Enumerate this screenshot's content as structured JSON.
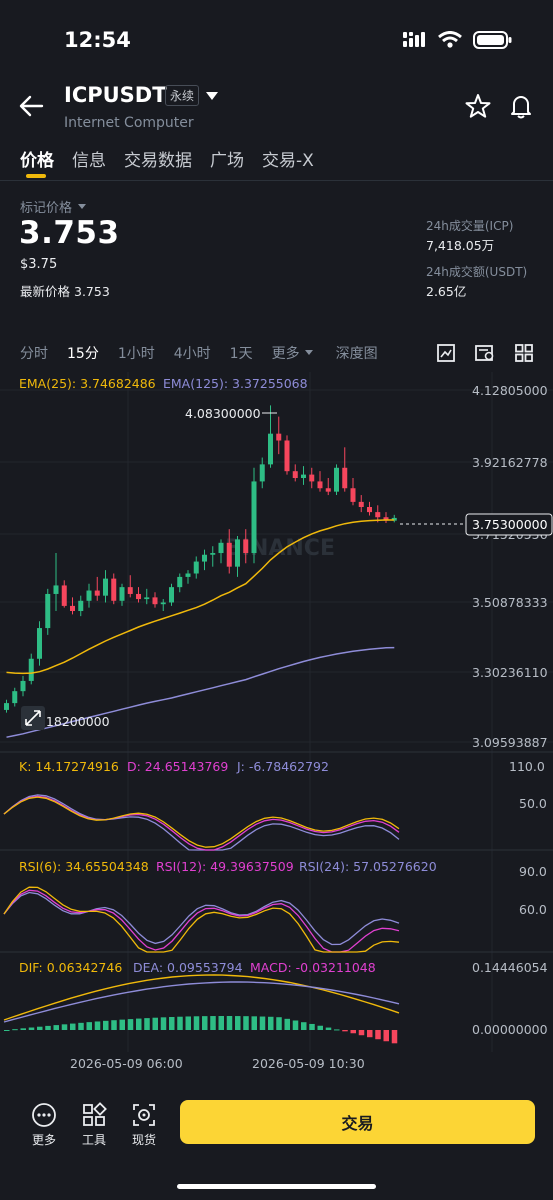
{
  "status": {
    "time": "12:54"
  },
  "header": {
    "symbol": "ICPUSDT",
    "contract_badge": "永续",
    "subtitle": "Internet Computer"
  },
  "tabs": [
    {
      "label": "价格",
      "active": true
    },
    {
      "label": "信息",
      "active": false
    },
    {
      "label": "交易数据",
      "active": false
    },
    {
      "label": "广场",
      "active": false
    },
    {
      "label": "交易-X",
      "active": false
    }
  ],
  "price": {
    "mark_label": "标记价格",
    "value": "3.753",
    "usd": "$3.75",
    "last_label": "最新价格",
    "last_value": "3.753",
    "vol_label": "24h成交量(ICP)",
    "vol_value": "7,418.05万",
    "amt_label": "24h成交额(USDT)",
    "amt_value": "2.65亿"
  },
  "timeframes": [
    {
      "label": "分时",
      "active": false
    },
    {
      "label": "15分",
      "active": true
    },
    {
      "label": "1小时",
      "active": false
    },
    {
      "label": "4小时",
      "active": false
    },
    {
      "label": "1天",
      "active": false
    },
    {
      "label": "更多",
      "active": false
    },
    {
      "label": "深度图",
      "active": false
    }
  ],
  "chart": {
    "ema_labels": [
      "EMA(25): 3.74682486",
      "EMA(125): 3.37255068"
    ],
    "y_ticks": [
      "4.12805000",
      "3.92162778",
      "3.71520556",
      "3.50878333",
      "3.30236110",
      "3.09593887"
    ],
    "current_price_tag": "3.75300000",
    "high_label": "4.08300000",
    "low_label": "3.18200000",
    "watermark": "BINANCE",
    "kdj_labels": [
      "K: 14.17274916",
      "D: 24.65143769",
      "J: -6.78462792"
    ],
    "kdj_ticks": [
      "110.0",
      "50.0"
    ],
    "rsi_labels": [
      "RSI(6): 34.65504348",
      "RSI(12): 49.39637509",
      "RSI(24): 57.05276620"
    ],
    "rsi_ticks": [
      "90.0",
      "60.0"
    ],
    "macd_labels": [
      "DIF: 0.06342746",
      "DEA: 0.09553794",
      "MACD: -0.03211048"
    ],
    "macd_ticks": [
      "0.14446054",
      "0.00000000"
    ],
    "time_labels": [
      "2026-05-09 06:00",
      "2026-05-09 10:30"
    ],
    "colors": {
      "up": "#2ebd85",
      "down": "#f6465d",
      "ema25": "#f0b90b",
      "ema125": "#8e8cd8",
      "k": "#f0b90b",
      "d": "#e040d0",
      "j": "#8e8cd8"
    }
  },
  "chart_data": {
    "type": "candlestick",
    "interval": "15分",
    "ylim": [
      3.09593887,
      4.12805
    ],
    "y_ticks": [
      4.12805,
      3.92162778,
      3.71520556,
      3.50878333,
      3.3023611,
      3.09593887
    ],
    "candles": [
      [
        3.19,
        3.22,
        3.182,
        3.21
      ],
      [
        3.21,
        3.255,
        3.2,
        3.245
      ],
      [
        3.245,
        3.29,
        3.23,
        3.275
      ],
      [
        3.275,
        3.355,
        3.265,
        3.34
      ],
      [
        3.34,
        3.45,
        3.32,
        3.43
      ],
      [
        3.43,
        3.545,
        3.41,
        3.53
      ],
      [
        3.53,
        3.65,
        3.48,
        3.555
      ],
      [
        3.555,
        3.57,
        3.49,
        3.495
      ],
      [
        3.495,
        3.52,
        3.47,
        3.48
      ],
      [
        3.48,
        3.525,
        3.465,
        3.51
      ],
      [
        3.51,
        3.56,
        3.49,
        3.54
      ],
      [
        3.54,
        3.58,
        3.51,
        3.525
      ],
      [
        3.525,
        3.6,
        3.505,
        3.575
      ],
      [
        3.575,
        3.59,
        3.5,
        3.51
      ],
      [
        3.51,
        3.56,
        3.495,
        3.55
      ],
      [
        3.55,
        3.585,
        3.52,
        3.53
      ],
      [
        3.53,
        3.55,
        3.505,
        3.515
      ],
      [
        3.515,
        3.545,
        3.5,
        3.52
      ],
      [
        3.52,
        3.535,
        3.49,
        3.5
      ],
      [
        3.5,
        3.515,
        3.48,
        3.505
      ],
      [
        3.505,
        3.56,
        3.495,
        3.55
      ],
      [
        3.55,
        3.59,
        3.535,
        3.58
      ],
      [
        3.58,
        3.6,
        3.56,
        3.59
      ],
      [
        3.59,
        3.64,
        3.575,
        3.625
      ],
      [
        3.625,
        3.66,
        3.6,
        3.645
      ],
      [
        3.645,
        3.67,
        3.61,
        3.65
      ],
      [
        3.65,
        3.69,
        3.62,
        3.68
      ],
      [
        3.68,
        3.72,
        3.59,
        3.61
      ],
      [
        3.61,
        3.7,
        3.58,
        3.69
      ],
      [
        3.69,
        3.72,
        3.62,
        3.65
      ],
      [
        3.65,
        3.9,
        3.62,
        3.86
      ],
      [
        3.86,
        3.93,
        3.84,
        3.91
      ],
      [
        3.91,
        4.083,
        3.9,
        4.0
      ],
      [
        4.0,
        4.05,
        3.94,
        3.98
      ],
      [
        3.98,
        3.995,
        3.88,
        3.89
      ],
      [
        3.89,
        3.91,
        3.86,
        3.87
      ],
      [
        3.87,
        3.905,
        3.85,
        3.88
      ],
      [
        3.88,
        3.9,
        3.84,
        3.86
      ],
      [
        3.86,
        3.89,
        3.83,
        3.84
      ],
      [
        3.84,
        3.87,
        3.82,
        3.83
      ],
      [
        3.83,
        3.91,
        3.82,
        3.9
      ],
      [
        3.9,
        3.96,
        3.83,
        3.84
      ],
      [
        3.84,
        3.87,
        3.79,
        3.8
      ],
      [
        3.8,
        3.82,
        3.77,
        3.785
      ],
      [
        3.785,
        3.8,
        3.76,
        3.77
      ],
      [
        3.77,
        3.79,
        3.74,
        3.755
      ],
      [
        3.755,
        3.77,
        3.738,
        3.745
      ],
      [
        3.745,
        3.762,
        3.74,
        3.753
      ]
    ],
    "ema25": [
      3.3,
      3.298,
      3.297,
      3.298,
      3.302,
      3.31,
      3.32,
      3.33,
      3.342,
      3.355,
      3.368,
      3.38,
      3.392,
      3.403,
      3.413,
      3.423,
      3.433,
      3.442,
      3.45,
      3.458,
      3.466,
      3.474,
      3.482,
      3.49,
      3.5,
      3.512,
      3.525,
      3.535,
      3.548,
      3.56,
      3.582,
      3.605,
      3.63,
      3.65,
      3.668,
      3.682,
      3.695,
      3.706,
      3.715,
      3.722,
      3.73,
      3.736,
      3.74,
      3.743,
      3.745,
      3.746,
      3.747,
      3.747
    ],
    "ema125": [
      3.11,
      3.115,
      3.12,
      3.126,
      3.132,
      3.138,
      3.144,
      3.15,
      3.156,
      3.162,
      3.168,
      3.174,
      3.18,
      3.186,
      3.192,
      3.198,
      3.204,
      3.21,
      3.215,
      3.22,
      3.225,
      3.231,
      3.237,
      3.243,
      3.249,
      3.255,
      3.261,
      3.267,
      3.273,
      3.279,
      3.287,
      3.295,
      3.303,
      3.311,
      3.318,
      3.325,
      3.332,
      3.338,
      3.344,
      3.349,
      3.354,
      3.358,
      3.362,
      3.365,
      3.368,
      3.37,
      3.372,
      3.3726
    ]
  }
}
